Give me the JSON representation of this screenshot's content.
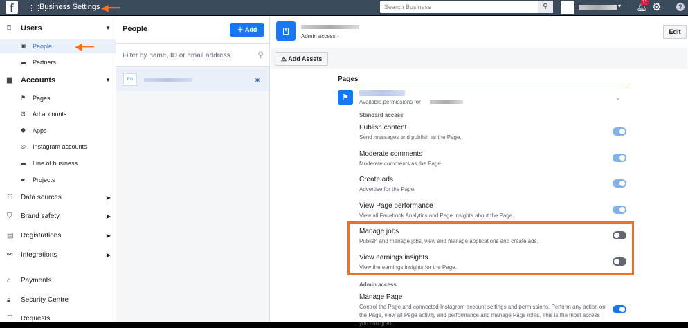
{
  "topbar": {
    "title": "Business Settings",
    "search_placeholder": "Search Business",
    "notification_count": "11"
  },
  "sidebar": {
    "items": [
      {
        "label": "Users",
        "icon": "users-icon",
        "type": "head"
      },
      {
        "label": "People",
        "icon": "person-icon",
        "type": "sub",
        "selected": true
      },
      {
        "label": "Partners",
        "icon": "briefcase-icon",
        "type": "sub"
      },
      {
        "label": "Accounts",
        "icon": "archive-icon",
        "type": "head"
      },
      {
        "label": "Pages",
        "icon": "flag-icon",
        "type": "sub"
      },
      {
        "label": "Ad accounts",
        "icon": "ad-icon",
        "type": "sub"
      },
      {
        "label": "Apps",
        "icon": "cube-icon",
        "type": "sub"
      },
      {
        "label": "Instagram accounts",
        "icon": "instagram-icon",
        "type": "sub"
      },
      {
        "label": "Line of business",
        "icon": "briefcase-icon",
        "type": "sub"
      },
      {
        "label": "Projects",
        "icon": "folder-icon",
        "type": "sub"
      },
      {
        "label": "Data sources",
        "icon": "data-icon",
        "type": "item"
      },
      {
        "label": "Brand safety",
        "icon": "shield-icon",
        "type": "item"
      },
      {
        "label": "Registrations",
        "icon": "clipboard-icon",
        "type": "item"
      },
      {
        "label": "Integrations",
        "icon": "integrations-icon",
        "type": "item"
      },
      {
        "label": "Payments",
        "icon": "bank-icon",
        "type": "item"
      },
      {
        "label": "Security Centre",
        "icon": "lock-icon",
        "type": "item"
      },
      {
        "label": "Requests",
        "icon": "requests-icon",
        "type": "item"
      }
    ]
  },
  "people": {
    "title": "People",
    "add_label": "Add",
    "filter_placeholder": "Filter by name, ID or email address",
    "person_initials": "RN"
  },
  "detail": {
    "access": "Admin access -",
    "edit_label": "Edit",
    "add_assets_label": "Add Assets",
    "pages_tab": "Pages",
    "available_for": "Available permissions for",
    "standard_heading": "Standard access",
    "admin_heading": "Admin access",
    "permissions": [
      {
        "title": "Publish content",
        "desc": "Send messages and publish as the Page.",
        "state": "on"
      },
      {
        "title": "Moderate comments",
        "desc": "Moderate comments as the Page.",
        "state": "on"
      },
      {
        "title": "Create ads",
        "desc": "Advertise for the Page.",
        "state": "on"
      },
      {
        "title": "View Page performance",
        "desc": "View all Facebook Analytics and Page Insights about the Page.",
        "state": "on"
      },
      {
        "title": "Manage jobs",
        "desc": "Publish and manage jobs, view and manage applications and create ads.",
        "state": "off"
      },
      {
        "title": "View earnings insights",
        "desc": "View the earnings insights for the Page.",
        "state": "off"
      }
    ],
    "admin_permission": {
      "title": "Manage Page",
      "desc": "Control the Page and connected Instagram account settings and permissions. Perform any action on the Page, view all Page activity and performance and manage Page roles. This is the most access you can grant.",
      "state": "on"
    }
  },
  "colors": {
    "highlight": "#f37021",
    "accent": "#1877f2"
  }
}
